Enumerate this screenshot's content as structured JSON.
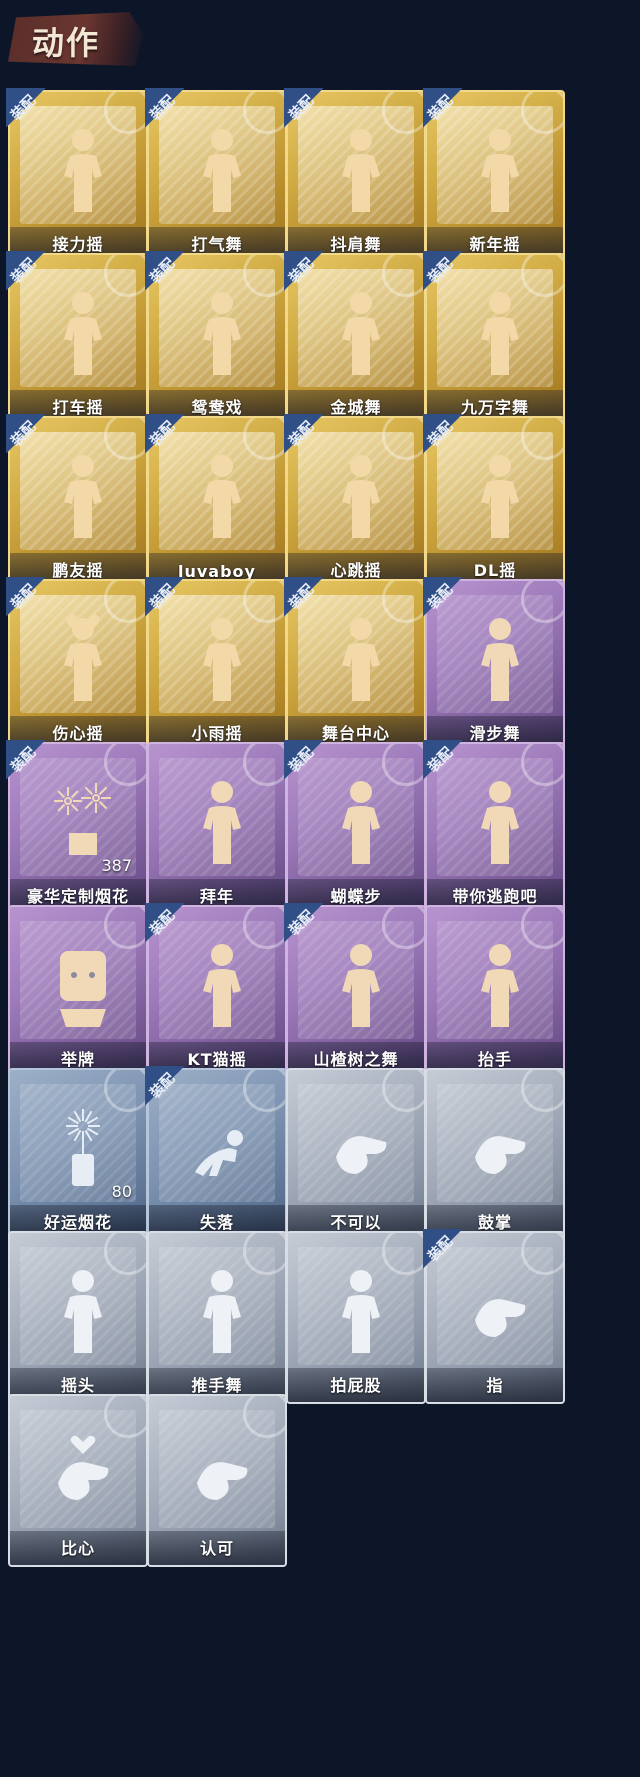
{
  "section": {
    "title": "动作"
  },
  "badge_text": "装配",
  "rarity_colors": {
    "gold": "#d2ad46",
    "purple": "#9c79b9",
    "bluegray": "#7d93b1",
    "gray": "#a7afbd",
    "badge": "#2b4c82"
  },
  "items": [
    {
      "label": "接力摇",
      "rarity": "gold",
      "equipped": true,
      "icon": "dance-pose-icon"
    },
    {
      "label": "打气舞",
      "rarity": "gold",
      "equipped": true,
      "icon": "dance-pose-icon"
    },
    {
      "label": "抖肩舞",
      "rarity": "gold",
      "equipped": true,
      "icon": "dance-pose-icon"
    },
    {
      "label": "新年摇",
      "rarity": "gold",
      "equipped": true,
      "icon": "dance-pose-icon"
    },
    {
      "label": "打车摇",
      "rarity": "gold",
      "equipped": true,
      "icon": "dance-pose-icon"
    },
    {
      "label": "鸳鸯戏",
      "rarity": "gold",
      "equipped": true,
      "icon": "dance-pose-icon"
    },
    {
      "label": "金城舞",
      "rarity": "gold",
      "equipped": true,
      "icon": "dance-pose-icon"
    },
    {
      "label": "九万字舞",
      "rarity": "gold",
      "equipped": true,
      "icon": "dance-pose-icon"
    },
    {
      "label": "鹏友摇",
      "rarity": "gold",
      "equipped": true,
      "icon": "dance-pose-icon"
    },
    {
      "label": "luvaboy",
      "rarity": "gold",
      "equipped": true,
      "icon": "dance-pose-icon"
    },
    {
      "label": "心跳摇",
      "rarity": "gold",
      "equipped": true,
      "icon": "dance-pose-icon"
    },
    {
      "label": "DL摇",
      "rarity": "gold",
      "equipped": true,
      "icon": "dance-pose-icon"
    },
    {
      "label": "伤心摇",
      "rarity": "gold",
      "equipped": true,
      "icon": "heart-hands-icon"
    },
    {
      "label": "小雨摇",
      "rarity": "gold",
      "equipped": true,
      "icon": "dance-pose-icon"
    },
    {
      "label": "舞台中心",
      "rarity": "gold",
      "equipped": true,
      "icon": "dance-pose-icon"
    },
    {
      "label": "滑步舞",
      "rarity": "purple",
      "equipped": true,
      "icon": "dance-pose-icon"
    },
    {
      "label": "豪华定制烟花",
      "rarity": "purple",
      "equipped": true,
      "icon": "fireworks-icon",
      "count": "387"
    },
    {
      "label": "拜年",
      "rarity": "purple",
      "equipped": false,
      "icon": "bow-pose-icon"
    },
    {
      "label": "蝴蝶步",
      "rarity": "purple",
      "equipped": true,
      "icon": "dance-pose-icon"
    },
    {
      "label": "带你逃跑吧",
      "rarity": "purple",
      "equipped": true,
      "icon": "dance-pose-icon"
    },
    {
      "label": "举牌",
      "rarity": "purple",
      "equipped": false,
      "icon": "sign-hold-icon"
    },
    {
      "label": "KT猫摇",
      "rarity": "purple",
      "equipped": true,
      "icon": "dance-pose-icon"
    },
    {
      "label": "山楂树之舞",
      "rarity": "purple",
      "equipped": true,
      "icon": "dance-pose-icon"
    },
    {
      "label": "抬手",
      "rarity": "purple",
      "equipped": false,
      "icon": "raise-hand-icon"
    },
    {
      "label": "好运烟花",
      "rarity": "bluegray",
      "equipped": false,
      "icon": "firecracker-icon",
      "count": "80"
    },
    {
      "label": "失落",
      "rarity": "bluegray",
      "equipped": true,
      "icon": "crawl-pose-icon"
    },
    {
      "label": "不可以",
      "rarity": "gray",
      "equipped": false,
      "icon": "finger-wag-icon"
    },
    {
      "label": "鼓掌",
      "rarity": "gray",
      "equipped": false,
      "icon": "clap-icon"
    },
    {
      "label": "摇头",
      "rarity": "gray",
      "equipped": false,
      "icon": "shake-head-icon"
    },
    {
      "label": "推手舞",
      "rarity": "gray",
      "equipped": false,
      "icon": "dance-pose-icon"
    },
    {
      "label": "拍屁股",
      "rarity": "gray",
      "equipped": false,
      "icon": "dance-pose-icon"
    },
    {
      "label": "指",
      "rarity": "gray",
      "equipped": true,
      "icon": "point-hand-icon"
    },
    {
      "label": "比心",
      "rarity": "gray",
      "equipped": false,
      "icon": "finger-heart-icon"
    },
    {
      "label": "认可",
      "rarity": "gray",
      "equipped": false,
      "icon": "thumbs-up-icon"
    }
  ]
}
